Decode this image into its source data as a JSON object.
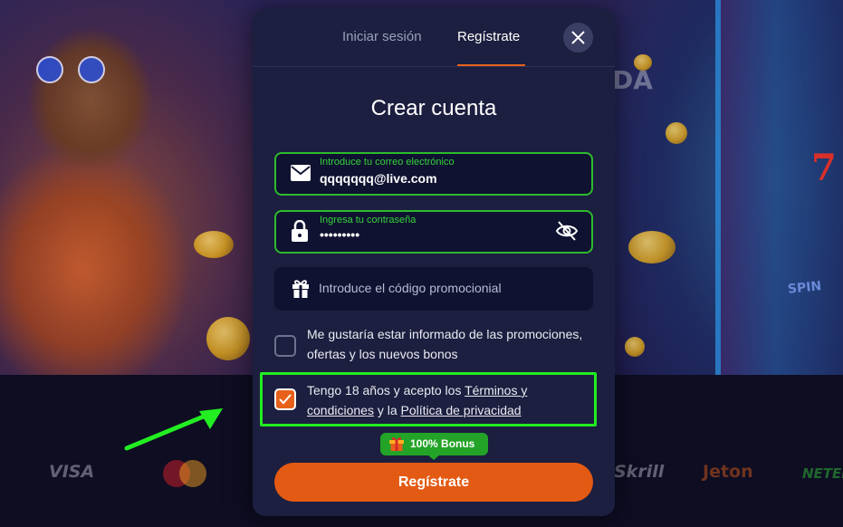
{
  "background": {
    "partial_title": "DA",
    "slot_seven": "7",
    "slot_spin": "SPIN",
    "payment_logos": [
      "VISA",
      "Skrill",
      "Jeton",
      "NETELL"
    ]
  },
  "tabs": {
    "login": "Iniciar sesión",
    "register": "Regístrate",
    "active": "register"
  },
  "close_icon": "close-icon",
  "form": {
    "title": "Crear cuenta",
    "email": {
      "label": "Introduce tu correo electrónico",
      "value": "qqqqqqq@live.com",
      "icon": "envelope-icon"
    },
    "password": {
      "label": "Ingresa tu contraseña",
      "value": "•••••••••",
      "icon": "lock-icon",
      "toggle_icon": "eye-off-icon"
    },
    "promo": {
      "placeholder": "Introduce el código promocionial",
      "icon": "gift-icon"
    },
    "newsletter": {
      "checked": false,
      "text": "Me gustaría estar informado de las promociones, ofertas y los nuevos bonos"
    },
    "terms": {
      "checked": true,
      "text_before": "Tengo 18 años y acepto los ",
      "terms_link": "Términos y condiciones",
      "text_middle": " y la ",
      "privacy_link": "Política de privacidad"
    },
    "bonus_badge": "100% Bonus",
    "submit_label": "Regístrate"
  },
  "colors": {
    "accent": "#e35a14",
    "valid": "#2dbb2e",
    "highlight": "#22ee22",
    "modal_bg": "#1c1f3f"
  }
}
